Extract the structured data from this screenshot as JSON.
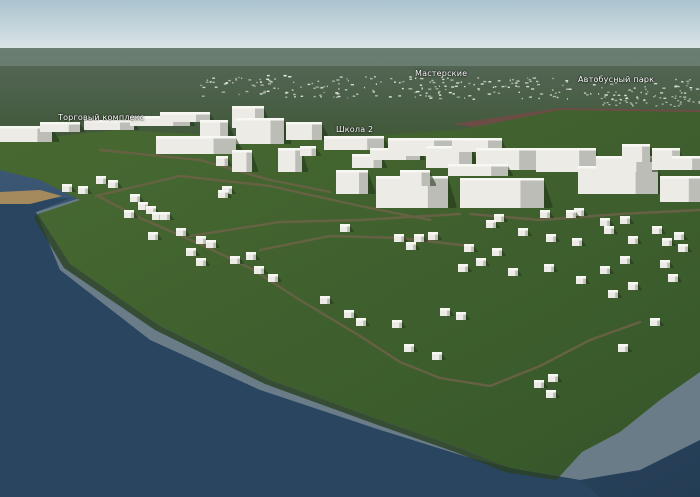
{
  "map": {
    "labels": {
      "mall": "Торговый комплекс",
      "school": "Школа 2",
      "workshops": "Мастерские",
      "bus_depot": "Автобусный парк"
    },
    "colors": {
      "sky_top": "#a9c3cf",
      "sky_bottom": "#dde6e6",
      "water": "#2f4a63",
      "grass": "#3f5f2c",
      "grass_dark": "#2f4a22",
      "field": "#6b4d45",
      "dirt_road": "#6b6247",
      "sand": "#a58a5e",
      "building": "#ecebe6",
      "building_shade": "#a9a9a4",
      "label_text": "#ffffff"
    }
  }
}
